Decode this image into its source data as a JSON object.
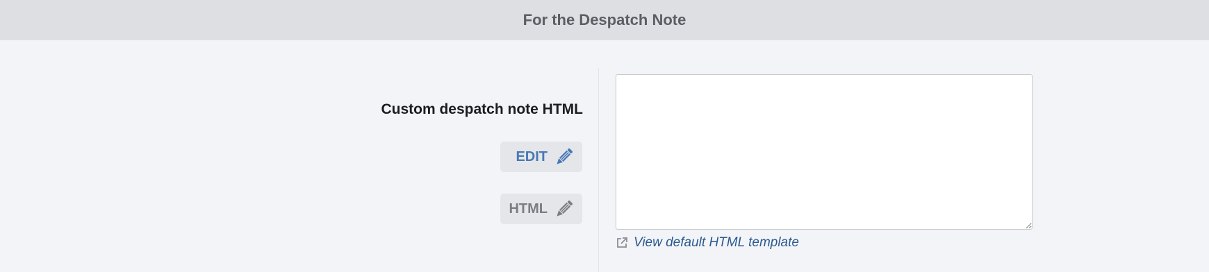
{
  "section": {
    "title": "For the Despatch Note"
  },
  "field": {
    "label": "Custom despatch note HTML",
    "value": "",
    "edit_label": "EDIT",
    "html_label": "HTML",
    "template_link": "View default HTML template"
  },
  "colors": {
    "header_bg": "#dddfe3",
    "page_bg": "#f3f4f7",
    "edit_accent": "#4a78b5",
    "html_muted": "#7a7d82",
    "link": "#2b5a8f"
  },
  "icons": {
    "edit": "pencil-icon",
    "html": "pencil-icon",
    "link": "external-link-icon"
  }
}
